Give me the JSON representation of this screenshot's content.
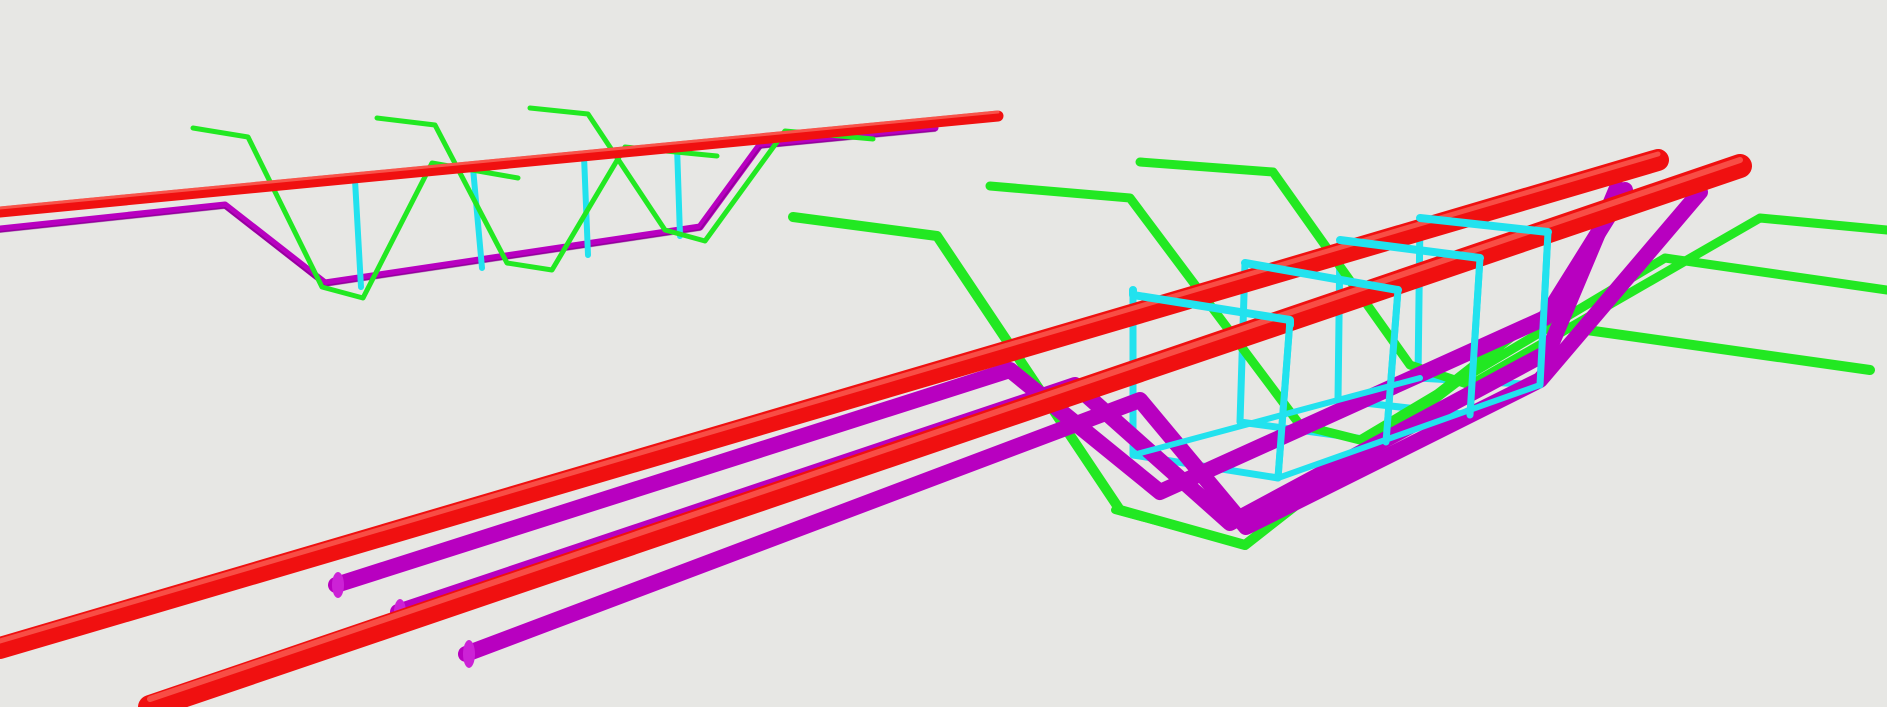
{
  "scene": {
    "background": "#e7e7e4",
    "materials": {
      "red": "#f01010",
      "magenta": "#b800c0",
      "green": "#22e822",
      "cyan": "#22e2ee"
    },
    "groups": [
      {
        "id": "far-assembly",
        "members": [
          "red-pipe",
          "magenta-pipe",
          "green-trusses",
          "cyan-stirrups"
        ]
      },
      {
        "id": "near-assembly",
        "members": [
          "red-pipes",
          "magenta-pipes",
          "green-trusses",
          "cyan-cage"
        ]
      }
    ]
  }
}
